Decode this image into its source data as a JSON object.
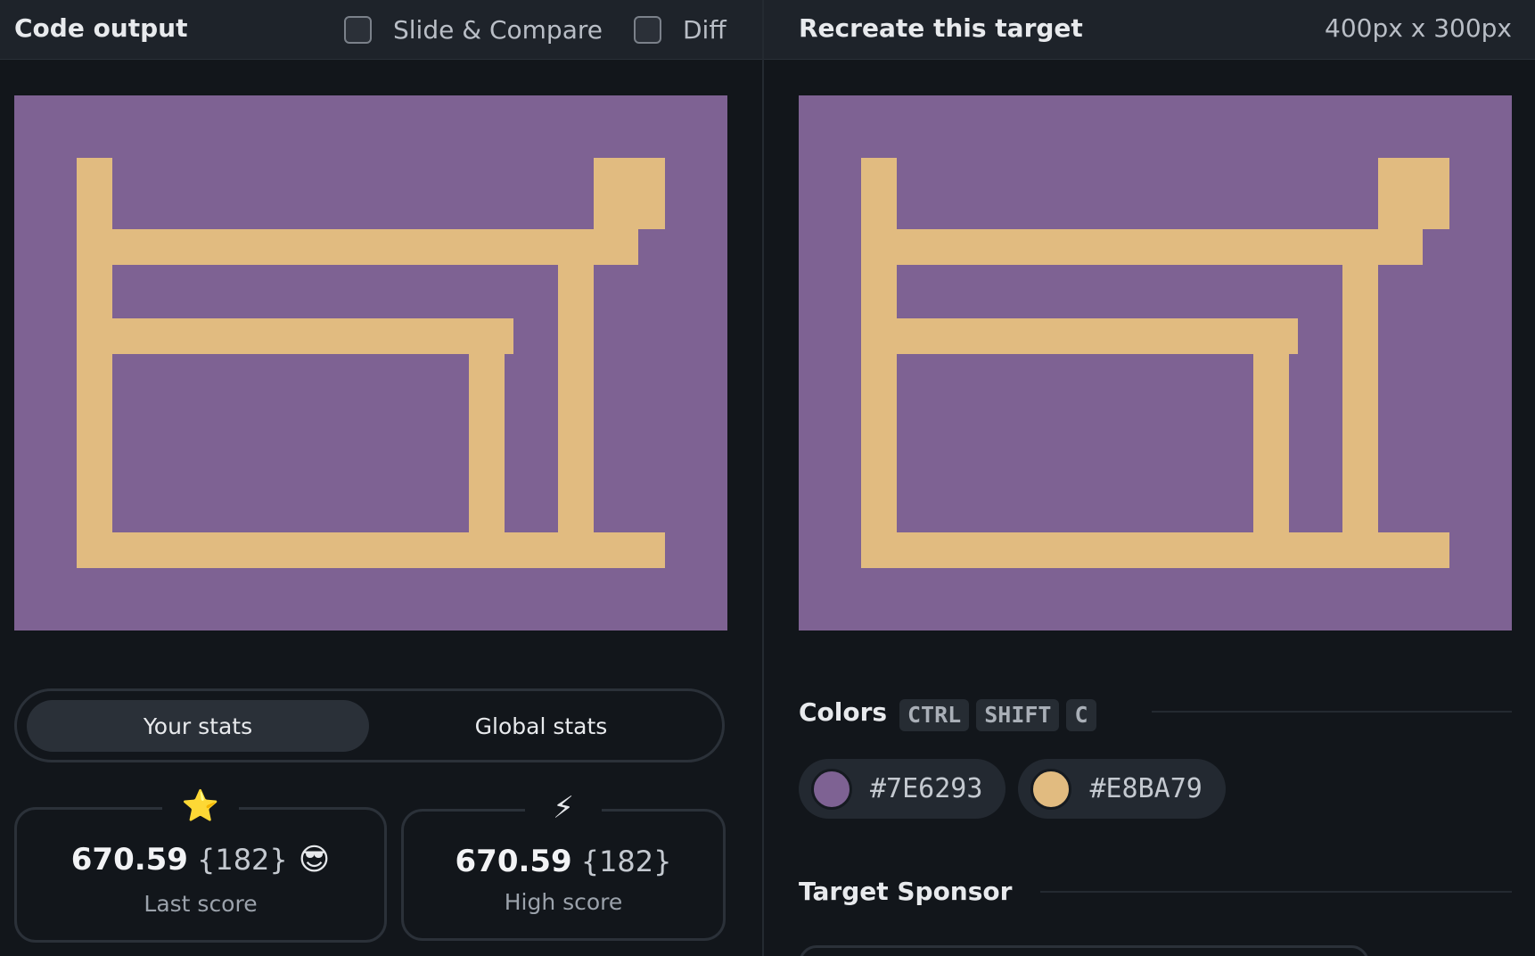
{
  "left_header": {
    "title": "Code output",
    "slide_compare_label": "Slide & Compare",
    "diff_label": "Diff"
  },
  "right_header": {
    "title": "Recreate this target",
    "dimensions": "400px x 300px"
  },
  "stats": {
    "your_stats_label": "Your stats",
    "global_stats_label": "Global stats",
    "last_score": {
      "badge_icon": "star-icon",
      "badge_glyph": "⭐",
      "value": "670.59",
      "count": "{182}",
      "emoji": "😎",
      "caption": "Last score"
    },
    "high_score": {
      "badge_icon": "lightning-icon",
      "badge_glyph": "⚡",
      "value": "670.59",
      "count": "{182}",
      "caption": "High score"
    }
  },
  "colors": {
    "title": "Colors",
    "shortcut_keys": [
      "CTRL",
      "SHIFT",
      "C"
    ],
    "swatches": [
      {
        "hex": "#7E6293",
        "color": "#7E6293"
      },
      {
        "hex": "#E8BA79",
        "color": "#E1BB80"
      }
    ]
  },
  "sponsor": {
    "title": "Target Sponsor"
  },
  "palette": {
    "canvas_bg": "#7E6293",
    "shape_fill": "#E1BB80"
  }
}
